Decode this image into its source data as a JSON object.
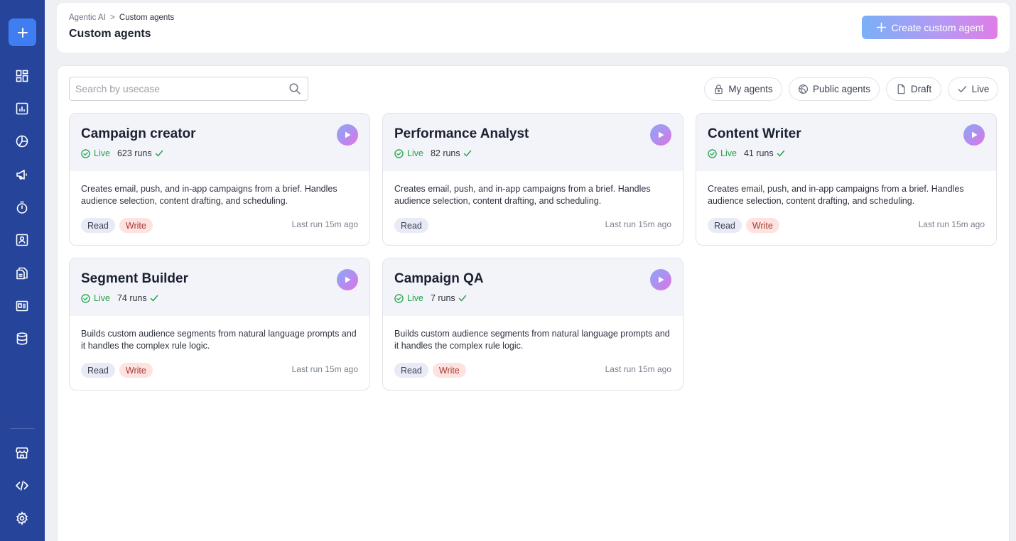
{
  "sidebar": {
    "add_icon": "plus-icon",
    "items": [
      {
        "icon": "dashboard-grid-icon"
      },
      {
        "icon": "bar-chart-icon"
      },
      {
        "icon": "pie-chart-icon"
      },
      {
        "icon": "megaphone-icon"
      },
      {
        "icon": "stopwatch-icon"
      },
      {
        "icon": "contact-card-icon"
      },
      {
        "icon": "documents-icon"
      },
      {
        "icon": "news-icon"
      },
      {
        "icon": "database-icon"
      }
    ],
    "bottom_items": [
      {
        "icon": "storefront-icon"
      },
      {
        "icon": "code-icon"
      },
      {
        "icon": "settings-gear-icon"
      }
    ]
  },
  "header": {
    "breadcrumb": {
      "parent": "Agentic AI",
      "separator": ">",
      "current": "Custom agents"
    },
    "title": "Custom agents",
    "create_button": "Create custom agent"
  },
  "search": {
    "placeholder": "Search by usecase",
    "value": ""
  },
  "filters": [
    {
      "label": "My agents",
      "icon": "lock-icon"
    },
    {
      "label": "Public agents",
      "icon": "globe-icon"
    },
    {
      "label": "Draft",
      "icon": "document-icon"
    },
    {
      "label": "Live",
      "icon": "check-icon"
    }
  ],
  "agents": [
    {
      "name": "Campaign creator",
      "status": "Live",
      "runs": "623 runs",
      "description": "Creates email, push, and in-app campaigns from a brief. Handles audience selection, content drafting, and scheduling.",
      "tags": [
        "Read",
        "Write"
      ],
      "last_run": "Last run 15m ago"
    },
    {
      "name": "Performance Analyst",
      "status": "Live",
      "runs": "82 runs",
      "description": "Creates email, push, and in-app campaigns from a brief. Handles audience selection, content drafting, and scheduling.",
      "tags": [
        "Read"
      ],
      "last_run": "Last run 15m ago"
    },
    {
      "name": "Content Writer",
      "status": "Live",
      "runs": "41 runs",
      "description": "Creates email, push, and in-app campaigns from a brief. Handles audience selection, content drafting, and scheduling.",
      "tags": [
        "Read",
        "Write"
      ],
      "last_run": "Last run 15m ago"
    },
    {
      "name": "Segment Builder",
      "status": "Live",
      "runs": "74 runs",
      "description": "Builds custom audience segments from natural language prompts and it handles the complex rule logic.",
      "tags": [
        "Read",
        "Write"
      ],
      "last_run": "Last run 15m ago"
    },
    {
      "name": "Campaign QA",
      "status": "Live",
      "runs": "7 runs",
      "description": "Builds custom audience segments from natural language prompts and it handles the complex rule logic.",
      "tags": [
        "Read",
        "Write"
      ],
      "last_run": "Last run 15m ago"
    }
  ],
  "colors": {
    "sidebar": "#25449a",
    "primary_action": "#3e7ef0",
    "live_green": "#22a447",
    "read_tag_bg": "#e8eaf6",
    "write_tag_bg": "#fde2e0"
  }
}
